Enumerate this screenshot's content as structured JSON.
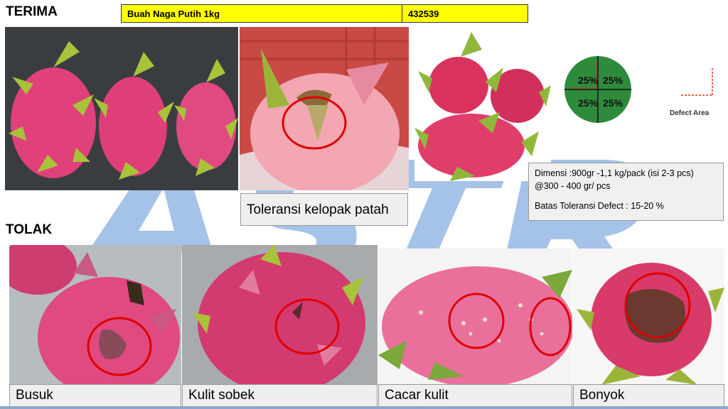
{
  "header": {
    "accept_label": "TERIMA",
    "reject_label": "TOLAK",
    "product_name": "Buah Naga Putih 1kg",
    "product_code": "432539"
  },
  "accept": {
    "caption_tolerance": "Toleransi kelopak patah"
  },
  "defect_chart": {
    "quadrants": [
      "25%",
      "25%",
      "25%",
      "25%"
    ],
    "legend_label": "Defect Area",
    "fill_color": "#2e8b3c",
    "marker_color": "#e03020"
  },
  "info": {
    "line1": "Dimensi :900gr -1,1 kg/pack (isi 2-3 pcs)",
    "line2": "@300 - 400 gr/ pcs",
    "line3": "Batas Toleransi Defect : 15-20 %"
  },
  "reject": {
    "captions": [
      "Busuk",
      "Kulit sobek",
      "Cacar kulit",
      "Bonyok"
    ]
  },
  "colors": {
    "header_bar": "#ffff00",
    "highlight_circle": "#dd0000",
    "fruit_pink": "#e0417a",
    "leaf_green": "#a8c23a"
  }
}
